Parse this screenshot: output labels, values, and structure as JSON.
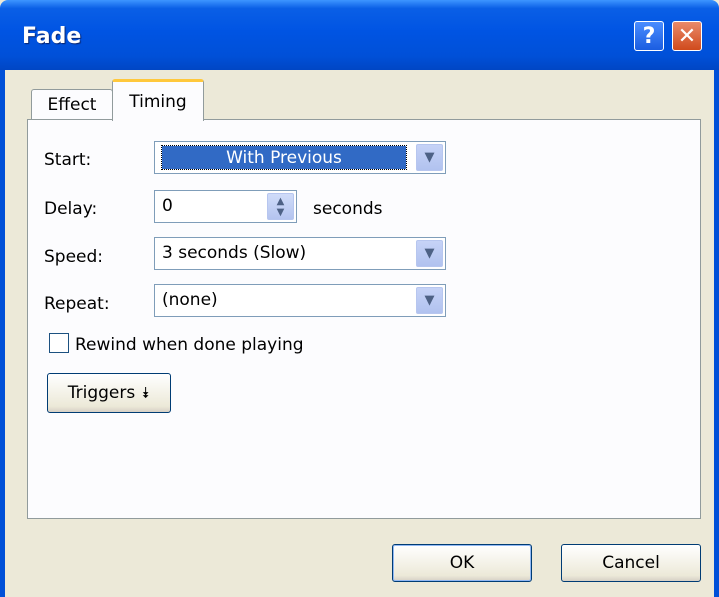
{
  "window": {
    "title": "Fade"
  },
  "titlebar_buttons": {
    "help": "?",
    "close": "✕"
  },
  "tabs": [
    {
      "label": "Effect",
      "active": false
    },
    {
      "label": "Timing",
      "active": true
    }
  ],
  "fields": {
    "start": {
      "label": "Start:",
      "value": "With Previous"
    },
    "delay": {
      "label": "Delay:",
      "value": "0",
      "unit": "seconds"
    },
    "speed": {
      "label": "Speed:",
      "value": "3 seconds (Slow)"
    },
    "repeat": {
      "label": "Repeat:",
      "value": "(none)"
    }
  },
  "rewind": {
    "label": "Rewind when done playing",
    "checked": false
  },
  "triggers": {
    "label": "Triggers",
    "icon": "double-chevron-down-icon"
  },
  "footer": {
    "ok": "OK",
    "cancel": "Cancel"
  },
  "colors": {
    "titlebar": "#0054e3",
    "selection": "#316ac5",
    "active_tab_accent": "#ffc83c"
  }
}
